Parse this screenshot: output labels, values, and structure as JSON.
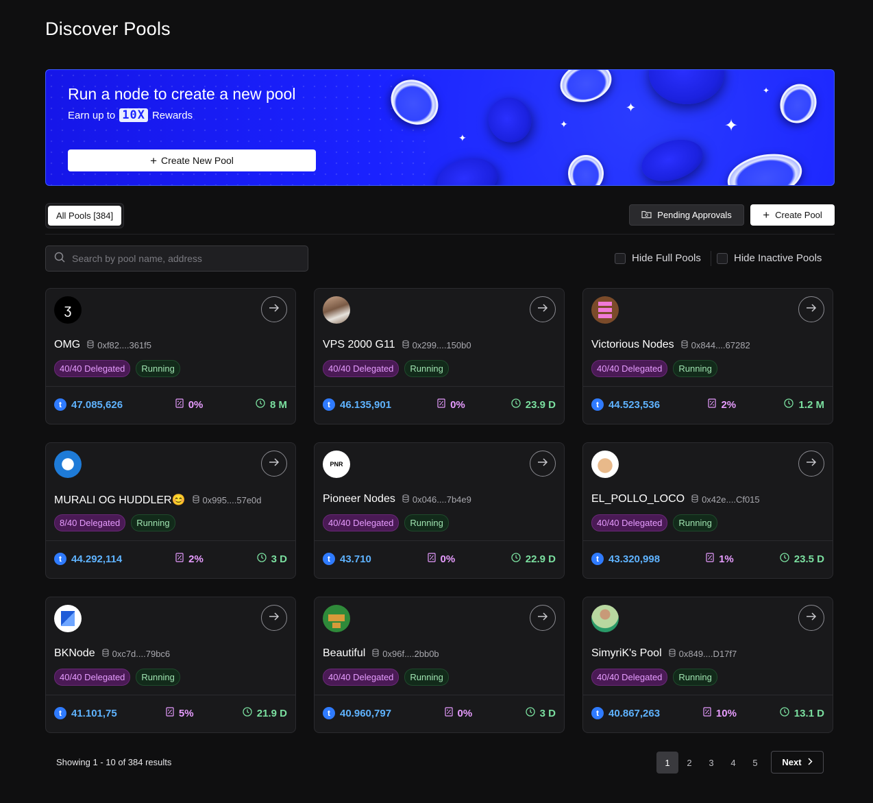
{
  "page": {
    "title": "Discover Pools"
  },
  "banner": {
    "headline": "Run a node to create a new pool",
    "sub_prefix": "Earn up to",
    "sub_highlight": "10X",
    "sub_suffix": "Rewards",
    "button_label": "Create New Pool",
    "colors": {
      "background": "#1a22ff",
      "border": "#3b5cff"
    }
  },
  "filters": {
    "tab_all": "All Pools [384]",
    "pending_label": "Pending Approvals",
    "create_pool_label": "Create Pool",
    "search_placeholder": "Search by pool name, address",
    "hide_full": "Hide Full Pools",
    "hide_inactive": "Hide Inactive Pools"
  },
  "colors": {
    "stake": "#5fb3ff",
    "commission": "#e79cff",
    "duration": "#7be0a0",
    "delegated_badge_bg": "#4a1a55",
    "running_badge_bg": "#122a1a"
  },
  "pools": [
    {
      "name": "OMG",
      "address": "0xf82....361f5",
      "delegated": "40/40 Delegated",
      "status": "Running",
      "stake": "47.085,626",
      "commission": "0%",
      "duration": "8 M",
      "avatar": "swirl-logo"
    },
    {
      "name": "VPS 2000 G11",
      "address": "0x299....150b0",
      "delegated": "40/40 Delegated",
      "status": "Running",
      "stake": "46.135,901",
      "commission": "0%",
      "duration": "23.9 D",
      "avatar": "person-photo"
    },
    {
      "name": "Victorious Nodes",
      "address": "0x844....67282",
      "delegated": "40/40 Delegated",
      "status": "Running",
      "stake": "44.523,536",
      "commission": "2%",
      "duration": "1.2 M",
      "avatar": "pixel-pink"
    },
    {
      "name": "MURALI OG HUDDLER😊",
      "address": "0x995....57e0d",
      "delegated": "8/40 Delegated",
      "status": "Running",
      "stake": "44.292,114",
      "commission": "2%",
      "duration": "3 D",
      "avatar": "blue-badge"
    },
    {
      "name": "Pioneer Nodes",
      "address": "0x046....7b4e9",
      "delegated": "40/40 Delegated",
      "status": "Running",
      "stake": "43.710",
      "commission": "0%",
      "duration": "22.9 D",
      "avatar": "pioneers-logo"
    },
    {
      "name": "EL_POLLO_LOCO",
      "address": "0x42e....Cf015",
      "delegated": "40/40 Delegated",
      "status": "Running",
      "stake": "43.320,998",
      "commission": "1%",
      "duration": "23.5 D",
      "avatar": "chicken"
    },
    {
      "name": "BKNode",
      "address": "0xc7d....79bc6",
      "delegated": "40/40 Delegated",
      "status": "Running",
      "stake": "41.101,75",
      "commission": "5%",
      "duration": "21.9 D",
      "avatar": "bk-logo"
    },
    {
      "name": "Beautiful",
      "address": "0x96f....2bb0b",
      "delegated": "40/40 Delegated",
      "status": "Running",
      "stake": "40.960,797",
      "commission": "0%",
      "duration": "3 D",
      "avatar": "pixel-green"
    },
    {
      "name": "SimyriK's Pool",
      "address": "0x849....D17f7",
      "delegated": "40/40 Delegated",
      "status": "Running",
      "stake": "40.867,263",
      "commission": "10%",
      "duration": "13.1 D",
      "avatar": "man-green"
    }
  ],
  "footer": {
    "showing": "Showing 1 - 10 of 384 results",
    "pages": [
      "1",
      "2",
      "3",
      "4",
      "5"
    ],
    "active_page": "1",
    "next_label": "Next"
  }
}
